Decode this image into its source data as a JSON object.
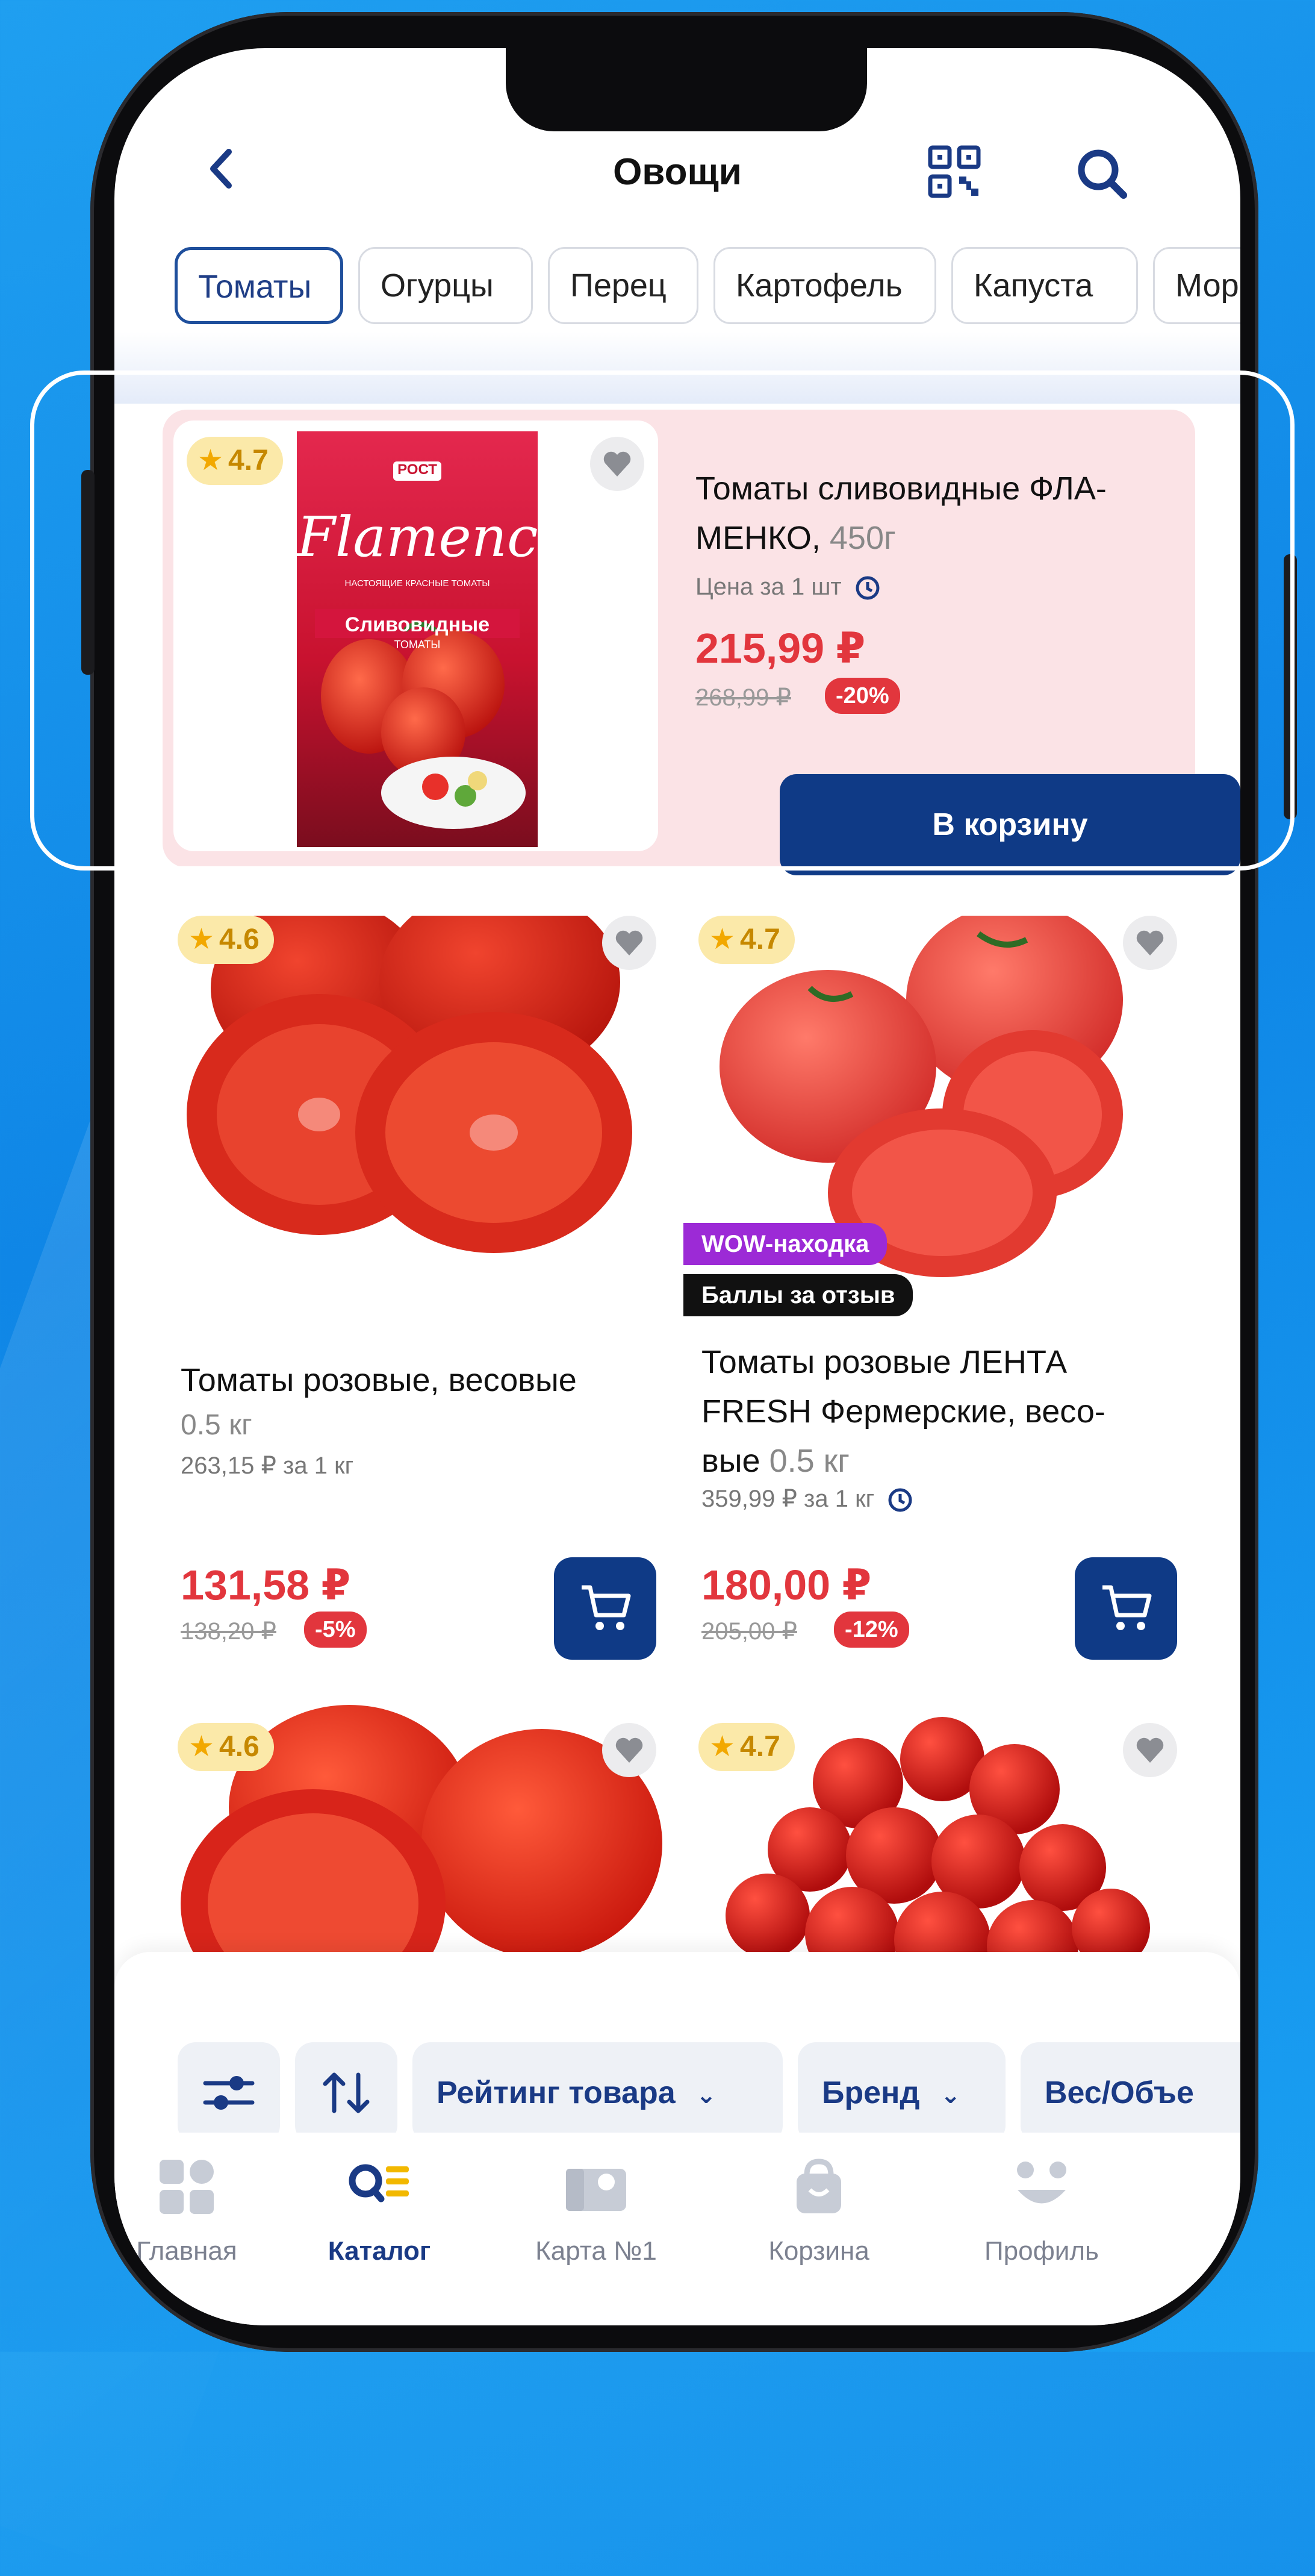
{
  "header": {
    "title": "Овощи"
  },
  "chips": [
    "Томаты",
    "Огурцы",
    "Перец",
    "Картофель",
    "Капуста",
    "Мор"
  ],
  "featured": {
    "rating": "4.7",
    "brand_logo": "РОСТ",
    "brand_script": "Flamenco",
    "pack_line1": "НАСТОЯЩИЕ КРАСНЫЕ ТОМАТЫ",
    "pack_line2": "Сливовидные",
    "pack_line3": "ТОМАТЫ",
    "name_line1": "Томаты сливовидные ФЛА-",
    "name_line2": "МЕНКО,",
    "weight": "450г",
    "unit_note": "Цена за 1 шт",
    "price": "215,99 ₽",
    "old_price": "268,99 ₽",
    "discount": "-20%",
    "button": "В корзину"
  },
  "products": [
    {
      "rating": "4.6",
      "name_line1": "Томаты розовые, весовые",
      "weight": "0.5 кг",
      "unit_price": "263,15 ₽ за 1 кг",
      "price": "131,58 ₽",
      "old_price": "138,20 ₽",
      "discount": "-5%"
    },
    {
      "rating": "4.7",
      "tag1": "WOW-находка",
      "tag2": "Баллы за отзыв",
      "name_line1": "Томаты розовые ЛЕНТА",
      "name_line2": "FRESH Фермерские, весо-",
      "name_line3": "вые",
      "weight": "0.5 кг",
      "unit_price": "359,99 ₽ за 1 кг",
      "price": "180,00 ₽",
      "old_price": "205,00 ₽",
      "discount": "-12%"
    },
    {
      "rating": "4.6"
    },
    {
      "rating": "4.7"
    }
  ],
  "filters": {
    "rating": "Рейтинг товара",
    "brand": "Бренд",
    "weight": "Вес/Объе"
  },
  "nav": [
    "Главная",
    "Каталог",
    "Карта №1",
    "Корзина",
    "Профиль"
  ],
  "colors": {
    "accent": "#0f3a86",
    "price": "#e2363d",
    "rating_bg": "#fbe9a9",
    "tag_wow": "#9c2ad6",
    "tag_points": "#111111"
  }
}
